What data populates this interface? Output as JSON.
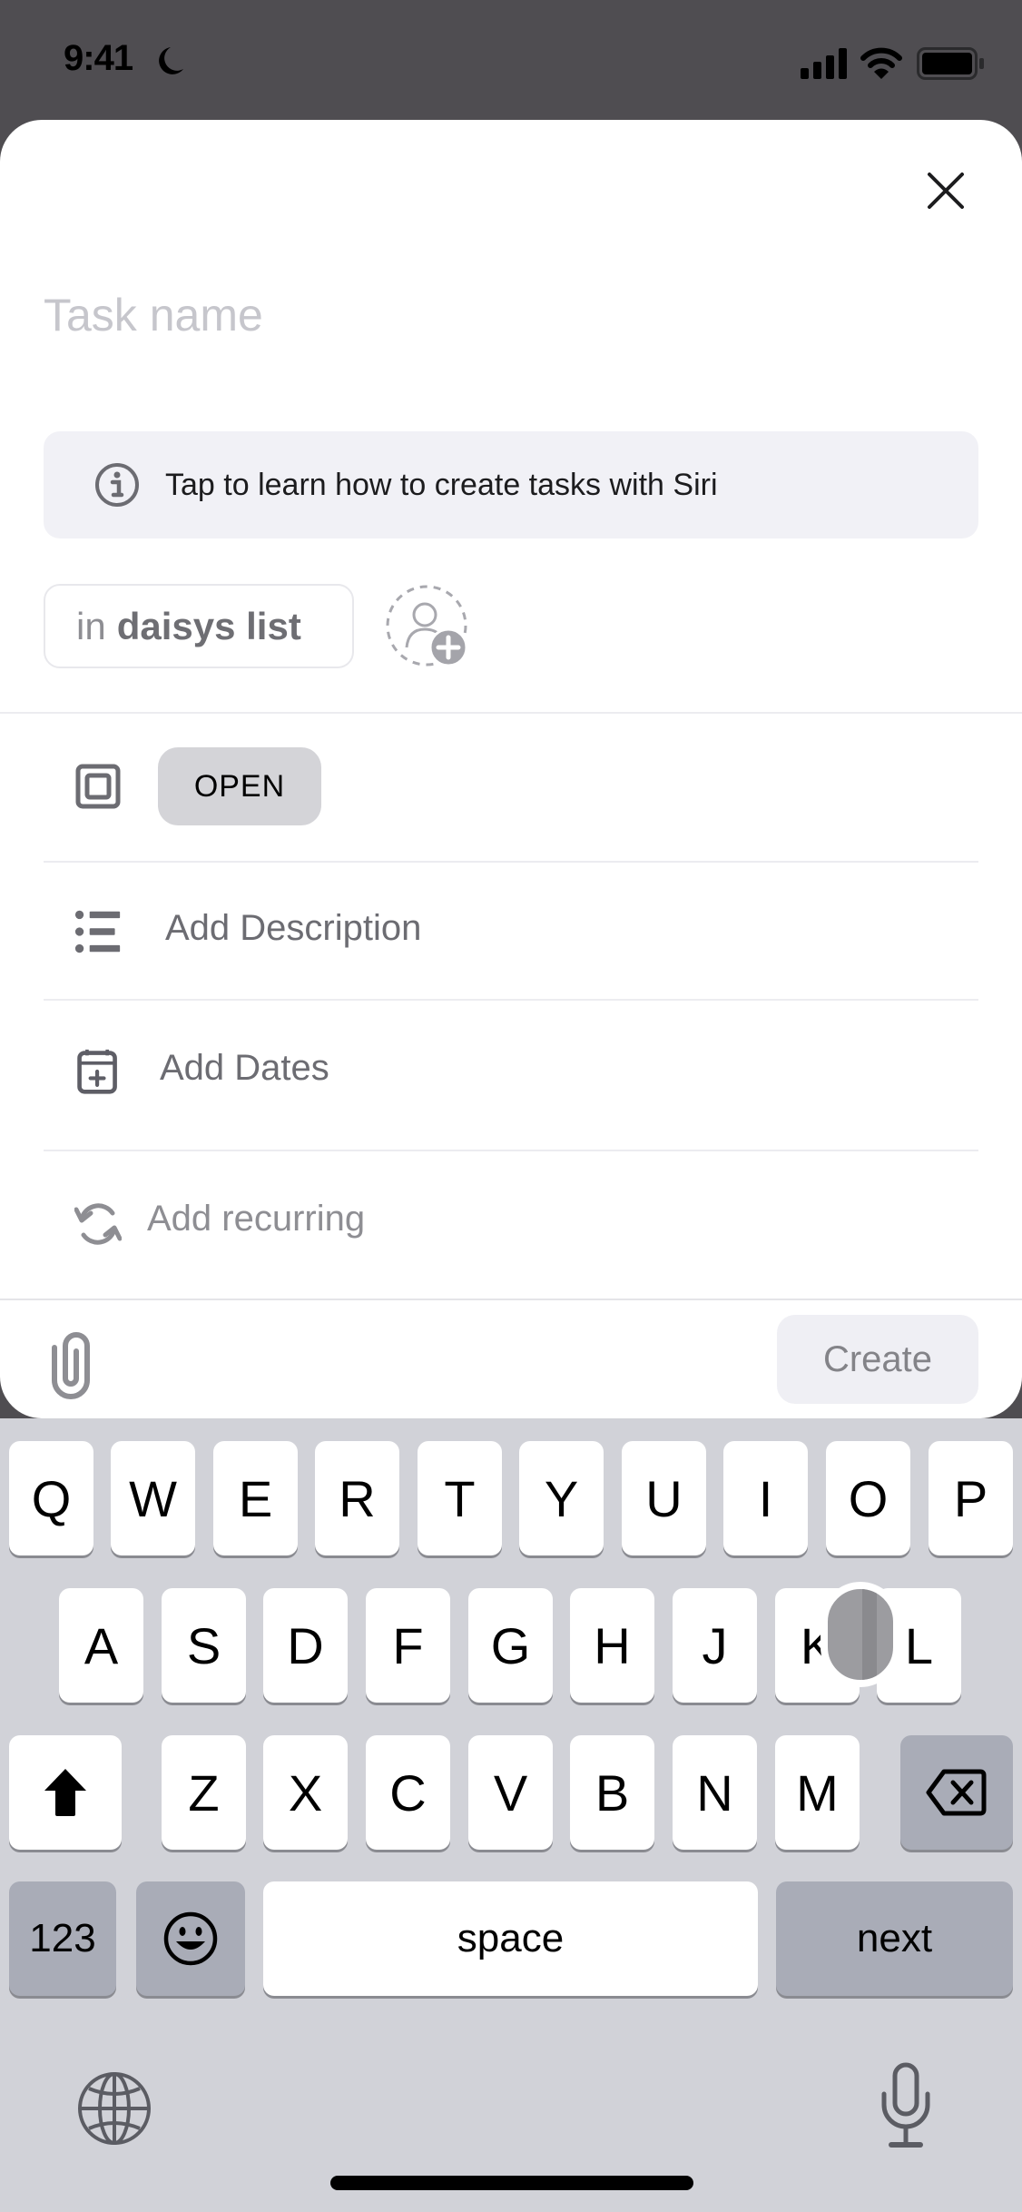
{
  "status_bar": {
    "time": "9:41",
    "icons": [
      "moon-icon",
      "cellular-signal-icon",
      "wifi-icon",
      "battery-icon"
    ]
  },
  "sheet": {
    "close_icon": "close-icon",
    "task_name": {
      "value": "",
      "placeholder": "Task name"
    },
    "siri_banner": {
      "icon": "info-icon",
      "text": "Tap to learn how to create tasks with Siri"
    },
    "list_chip": {
      "prefix": "in",
      "list_name": "daisys list"
    },
    "assignee": {
      "icon": "add-assignee-icon"
    },
    "rows": {
      "status": {
        "icon": "status-square-icon",
        "value": "OPEN"
      },
      "description": {
        "icon": "description-list-icon",
        "label": "Add Description"
      },
      "dates": {
        "icon": "calendar-add-icon",
        "label": "Add Dates"
      },
      "recurring": {
        "icon": "recurring-icon",
        "label": "Add recurring"
      }
    },
    "footer": {
      "attach_icon": "paperclip-icon",
      "create_label": "Create"
    }
  },
  "keyboard": {
    "row1": [
      "Q",
      "W",
      "E",
      "R",
      "T",
      "Y",
      "U",
      "I",
      "O",
      "P"
    ],
    "row2": [
      "A",
      "S",
      "D",
      "F",
      "G",
      "H",
      "J",
      "K",
      "L"
    ],
    "row3": [
      "Z",
      "X",
      "C",
      "V",
      "B",
      "N",
      "M"
    ],
    "shift_icon": "shift-icon",
    "backspace_icon": "backspace-icon",
    "numbers_label": "123",
    "emoji_icon": "emoji-icon",
    "space_label": "space",
    "return_label": "next",
    "globe_icon": "globe-icon",
    "mic_icon": "microphone-icon"
  },
  "colors": {
    "backdrop": "#4f4d51",
    "sheet_bg": "#ffffff",
    "banner_bg": "#f1f1f6",
    "status_chip_bg": "#d4d4d8",
    "icon_gray": "#6c6c72",
    "keyboard_bg": "#d1d2d8"
  }
}
